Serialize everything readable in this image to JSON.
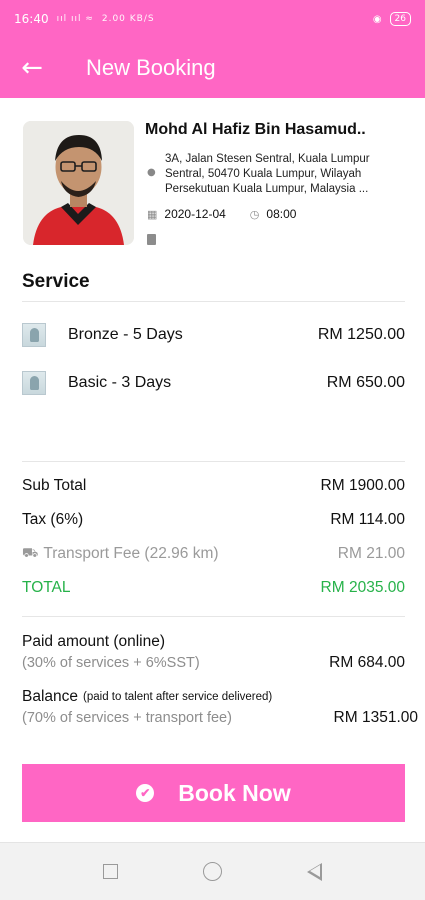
{
  "status_bar": {
    "time": "16:40",
    "signal": "ııl ııl ≈",
    "speed": "2.00 KB/S",
    "battery": "26"
  },
  "app_bar": {
    "title": "New Booking"
  },
  "talent": {
    "name": "Mohd Al Hafiz Bin Hasamud..",
    "address_lines": [
      "3A, Jalan Stesen Sentral, Kuala Lumpur",
      "Sentral, 50470 Kuala Lumpur, Wilayah",
      "Persekutuan Kuala Lumpur, Malaysia ..."
    ],
    "date": "2020-12-04",
    "time": "08:00"
  },
  "service_section": {
    "title": "Service",
    "items": [
      {
        "name": "Bronze - 5 Days",
        "price": "RM 1250.00"
      },
      {
        "name": "Basic - 3 Days",
        "price": "RM 650.00"
      }
    ]
  },
  "summary": {
    "sub_total_label": "Sub Total",
    "sub_total_value": "RM 1900.00",
    "tax_label": "Tax (6%)",
    "tax_value": "RM 114.00",
    "transport_label": "Transport Fee (22.96 km)",
    "transport_value": "RM 21.00",
    "total_label": "TOTAL",
    "total_value": "RM 2035.00"
  },
  "payment": {
    "paid_label": "Paid amount (online)",
    "paid_sub": "(30% of services + 6%SST)",
    "paid_value": "RM 684.00",
    "balance_label": "Balance",
    "balance_note": "(paid to talent after service delivered)",
    "balance_sub": "(70% of services + transport fee)",
    "balance_value": "RM 1351.00"
  },
  "book_button": {
    "label": "Book Now"
  },
  "colors": {
    "accent": "#ff66c4",
    "total_green": "#27b24a"
  }
}
